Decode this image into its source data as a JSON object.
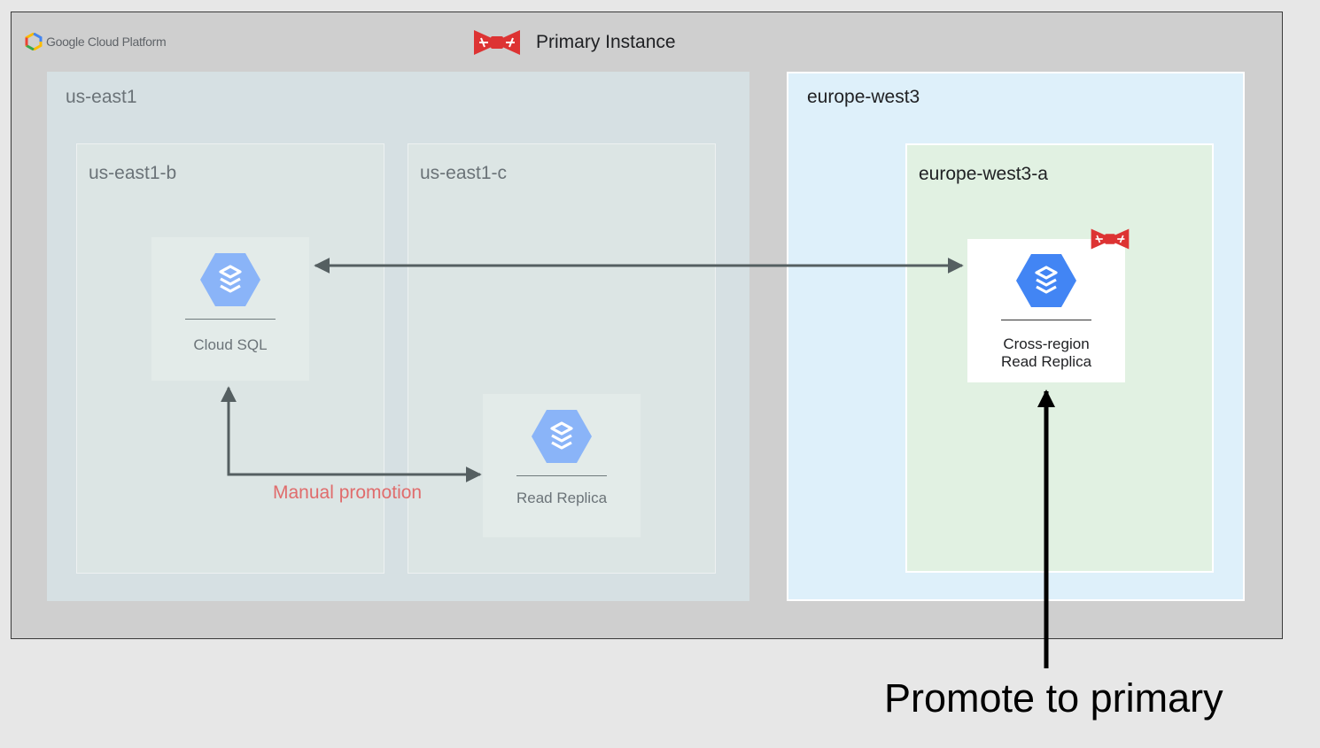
{
  "logo": {
    "text": "Google Cloud Platform",
    "icon": "google-cloud-hexagon-icon"
  },
  "legend": {
    "label": "Primary Instance",
    "icon": "bowtie-icon",
    "color": "#dd3333"
  },
  "regions": {
    "us_east1": {
      "label": "us-east1",
      "zones": {
        "b": "us-east1-b",
        "c": "us-east1-c"
      }
    },
    "europe_west3": {
      "label": "europe-west3",
      "zones": {
        "a": "europe-west3-a"
      }
    }
  },
  "nodes": {
    "cloud_sql": {
      "label": "Cloud SQL",
      "icon": "cloud-sql-icon"
    },
    "read_replica": {
      "label": "Read Replica",
      "icon": "cloud-sql-icon"
    },
    "cross_region": {
      "line1": "Cross-region",
      "line2": "Read Replica",
      "icon": "cloud-sql-icon",
      "badge": "bowtie-icon"
    }
  },
  "annotations": {
    "manual_promotion": "Manual promotion",
    "promote_to_primary": "Promote to primary"
  },
  "colors": {
    "frame_bg": "#cfcfcf",
    "us_region_bg": "#d6e0e3",
    "us_zone_bg": "#dce5e4",
    "eu_region_bg": "#def0fa",
    "eu_zone_bg": "#e1f1e2",
    "icon_faded": "#8ab4f8",
    "icon_active": "#4285f4",
    "arrow": "#555f61",
    "manual_promotion": "#e06c6c"
  }
}
